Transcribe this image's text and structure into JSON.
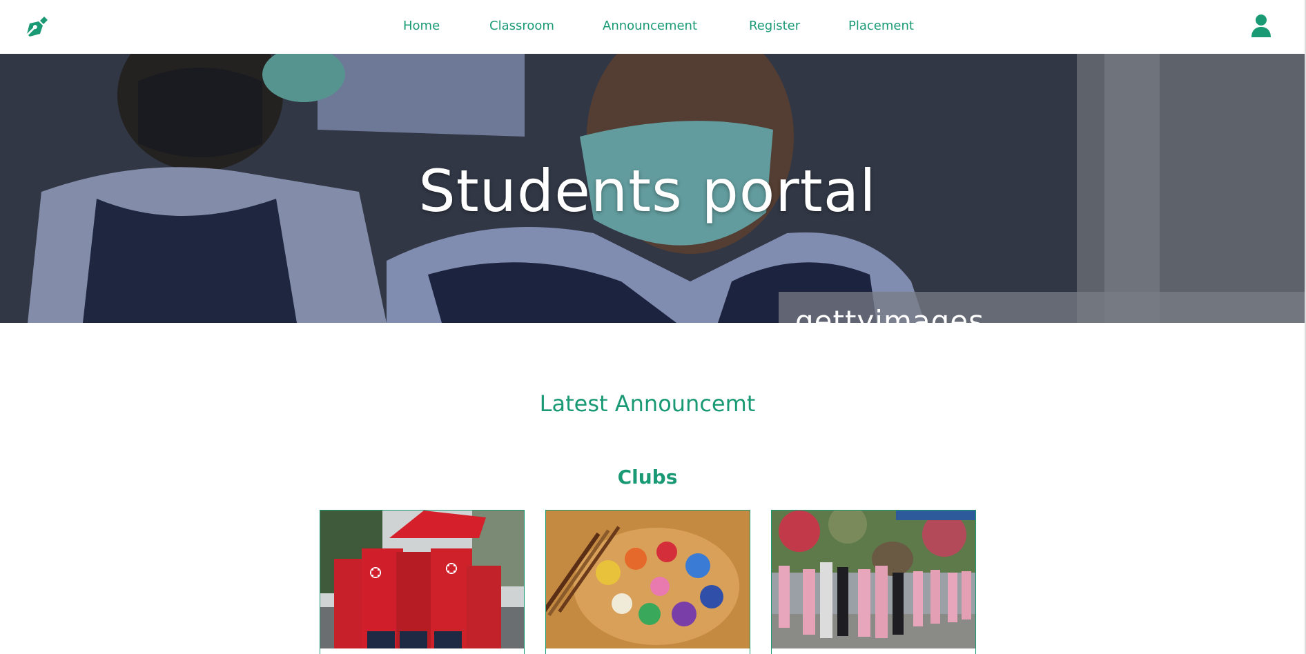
{
  "nav": {
    "logo_icon": "pen-nib-icon",
    "links": [
      "Home",
      "Classroom",
      "Announcement",
      "Register",
      "Placement"
    ],
    "user_icon": "user-icon"
  },
  "hero": {
    "title": "Students portal",
    "watermark": "gettyimages"
  },
  "latest": {
    "title": "Latest Announcemt"
  },
  "clubs": {
    "title": "Clubs",
    "cards": [
      {
        "image": "red-cross-club-photo"
      },
      {
        "image": "art-palette-photo"
      },
      {
        "image": "students-gathering-photo"
      }
    ]
  },
  "colors": {
    "accent": "#1a9a74",
    "background": "#ffffff"
  }
}
